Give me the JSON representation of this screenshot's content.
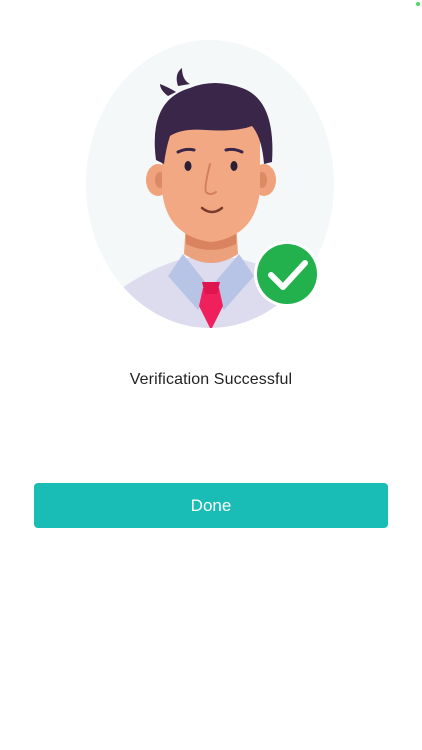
{
  "status": {
    "indicator_color": "#4cd964"
  },
  "illustration": {
    "description_icon": "user-avatar-illustration",
    "badge_icon": "check-circle-icon",
    "badge_color": "#22b14c"
  },
  "message": {
    "text": "Verification Successful"
  },
  "actions": {
    "done_label": "Done",
    "done_color": "#19bdb5"
  }
}
